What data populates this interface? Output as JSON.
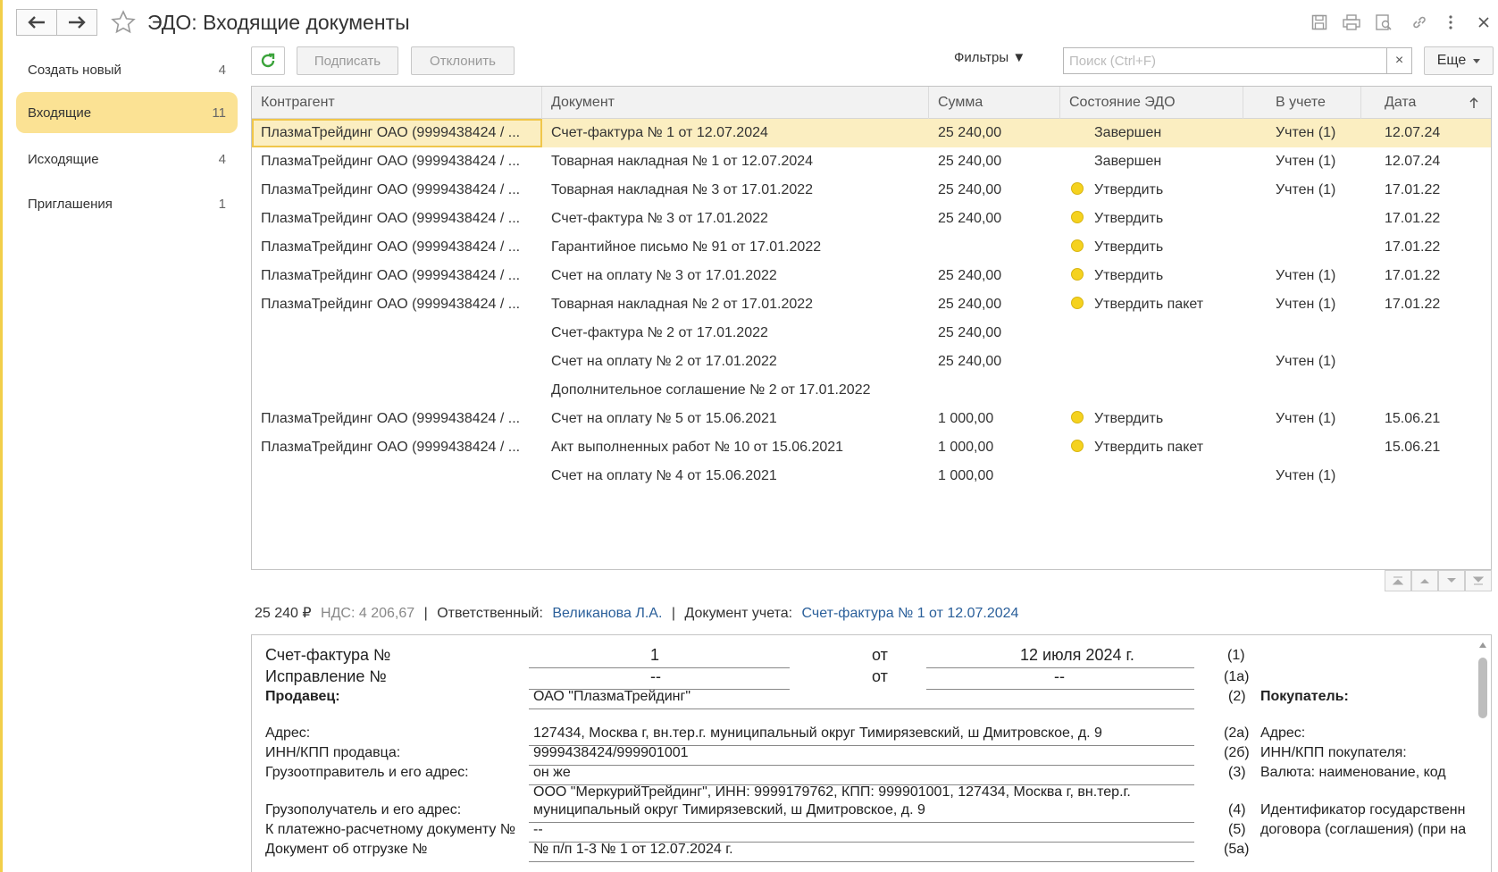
{
  "window": {
    "title": "ЭДО: Входящие документы"
  },
  "sidebar": {
    "items": [
      {
        "label": "Создать новый",
        "count": "4"
      },
      {
        "label": "Входящие",
        "count": "11"
      },
      {
        "label": "Исходящие",
        "count": "4"
      },
      {
        "label": "Приглашения",
        "count": "1"
      }
    ]
  },
  "toolbar": {
    "sign_label": "Подписать",
    "reject_label": "Отклонить",
    "filters_label": "Фильтры ▼",
    "search_placeholder": "Поиск (Ctrl+F)",
    "clear_label": "×",
    "more_label": "Еще"
  },
  "table": {
    "columns": [
      "Контрагент",
      "Документ",
      "Сумма",
      "Состояние ЭДО",
      "В учете",
      "Дата"
    ],
    "rows": [
      {
        "counterparty": "ПлазмаТрейдинг ОАО (9999438424 / ...",
        "document": "Счет-фактура № 1 от 12.07.2024",
        "sum": "25 240,00",
        "state": "Завершен",
        "dot": false,
        "account": "Учтен (1)",
        "date": "12.07.24"
      },
      {
        "counterparty": "ПлазмаТрейдинг ОАО (9999438424 / ...",
        "document": "Товарная накладная № 1 от 12.07.2024",
        "sum": "25 240,00",
        "state": "Завершен",
        "dot": false,
        "account": "Учтен (1)",
        "date": "12.07.24"
      },
      {
        "counterparty": "ПлазмаТрейдинг ОАО (9999438424 / ...",
        "document": "Товарная накладная № 3 от 17.01.2022",
        "sum": "25 240,00",
        "state": "Утвердить",
        "dot": true,
        "account": "Учтен (1)",
        "date": "17.01.22"
      },
      {
        "counterparty": "ПлазмаТрейдинг ОАО (9999438424 / ...",
        "document": "Счет-фактура № 3 от 17.01.2022",
        "sum": "25 240,00",
        "state": "Утвердить",
        "dot": true,
        "account": "",
        "date": "17.01.22"
      },
      {
        "counterparty": "ПлазмаТрейдинг ОАО (9999438424 / ...",
        "document": "Гарантийное письмо № 91 от 17.01.2022",
        "sum": "",
        "state": "Утвердить",
        "dot": true,
        "account": "",
        "date": "17.01.22"
      },
      {
        "counterparty": "ПлазмаТрейдинг ОАО (9999438424 / ...",
        "document": "Счет на оплату № 3 от 17.01.2022",
        "sum": "25 240,00",
        "state": "Утвердить",
        "dot": true,
        "account": "Учтен (1)",
        "date": "17.01.22"
      },
      {
        "counterparty": "ПлазмаТрейдинг ОАО (9999438424 / ...",
        "document": "Товарная накладная № 2 от 17.01.2022",
        "sum": "25 240,00",
        "state": "Утвердить пакет",
        "dot": true,
        "account": "Учтен (1)",
        "date": "17.01.22"
      },
      {
        "counterparty": "",
        "document": "Счет-фактура № 2 от 17.01.2022",
        "sum": "25 240,00",
        "state": "",
        "dot": false,
        "account": "",
        "date": ""
      },
      {
        "counterparty": "",
        "document": "Счет на оплату № 2 от 17.01.2022",
        "sum": "25 240,00",
        "state": "",
        "dot": false,
        "account": "Учтен (1)",
        "date": ""
      },
      {
        "counterparty": "",
        "document": "Дополнительное соглашение № 2 от 17.01.2022",
        "sum": "",
        "state": "",
        "dot": false,
        "account": "",
        "date": ""
      },
      {
        "counterparty": "ПлазмаТрейдинг ОАО (9999438424 / ...",
        "document": "Счет на оплату № 5 от 15.06.2021",
        "sum": "1 000,00",
        "state": "Утвердить",
        "dot": true,
        "account": "Учтен (1)",
        "date": "15.06.21"
      },
      {
        "counterparty": "ПлазмаТрейдинг ОАО (9999438424 / ...",
        "document": "Акт выполненных работ № 10 от 15.06.2021",
        "sum": "1 000,00",
        "state": "Утвердить пакет",
        "dot": true,
        "account": "",
        "date": "15.06.21"
      },
      {
        "counterparty": "",
        "document": "Счет на оплату № 4 от 15.06.2021",
        "sum": "1 000,00",
        "state": "",
        "dot": false,
        "account": "Учтен (1)",
        "date": ""
      }
    ]
  },
  "info": {
    "amount": "25 240 ₽",
    "vat": "НДС: 4 206,67",
    "responsible_label": "Ответственный:",
    "responsible": "Великанова Л.А.",
    "doc_label": "Документ учета:",
    "doc_link": "Счет-фактура № 1 от 12.07.2024"
  },
  "preview": {
    "invoice_label": "Счет-фактура №",
    "invoice_number": "1",
    "from1": "от",
    "invoice_date": "12 июля 2024 г.",
    "code1": "(1)",
    "correction_label": "Исправление №",
    "correction_number": "--",
    "from2": "от",
    "correction_date": "--",
    "code1a": "(1а)",
    "seller_label": "Продавец:",
    "seller": "ОАО \"ПлазмаТрейдинг\"",
    "code2": "(2)",
    "buyer_label": "Покупатель:",
    "address_label": "Адрес:",
    "address": "127434, Москва г, вн.тер.г. муниципальный округ Тимирязевский, ш Дмитровское, д. 9",
    "code2a": "(2а)",
    "buyer_address_label": "Адрес:",
    "inn_label": "ИНН/КПП продавца:",
    "inn": "9999438424/999901001",
    "code2b": "(2б)",
    "buyer_inn_label": "ИНН/КПП покупателя:",
    "shipper_label": "Грузоотправитель и его адрес:",
    "shipper": "он же",
    "code3": "(3)",
    "currency_label": "Валюта: наименование, код",
    "consignee_line1": "ООО \"МеркурийТрейдинг\", ИНН: 9999179762, КПП: 999901001, 127434, Москва г, вн.тер.г.",
    "consignee_label": "Грузополучатель и его адрес:",
    "consignee_line2": "муниципальный округ Тимирязевский, ш Дмитровское, д. 9",
    "code4": "(4)",
    "gov_id_label": "Идентификатор государственн",
    "payment_label": "К платежно-расчетному документу №",
    "payment": "--",
    "code5": "(5)",
    "contract_label": "договора (соглашения) (при на",
    "shipment_label": "Документ об отгрузке №",
    "shipment": "№ п/п 1-3 № 1 от 12.07.2024 г.",
    "code5a": "(5а)"
  }
}
